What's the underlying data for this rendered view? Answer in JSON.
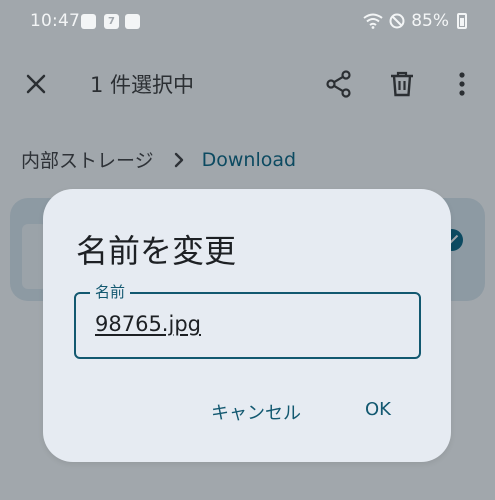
{
  "status_bar": {
    "time": "10:47",
    "notification_seven": "7",
    "battery": "85%"
  },
  "app_bar": {
    "title": "1 件選択中"
  },
  "breadcrumb": {
    "root": "内部ストレージ",
    "current": "Download"
  },
  "dialog": {
    "title": "名前を変更",
    "field_label": "名前",
    "field_value": "98765.jpg",
    "cancel_label": "キャンセル",
    "ok_label": "OK"
  },
  "colors": {
    "scrim": "#a1a7ac",
    "dialog_bg": "#e6ebf2",
    "accent": "#125870",
    "text": "#1d2024"
  }
}
